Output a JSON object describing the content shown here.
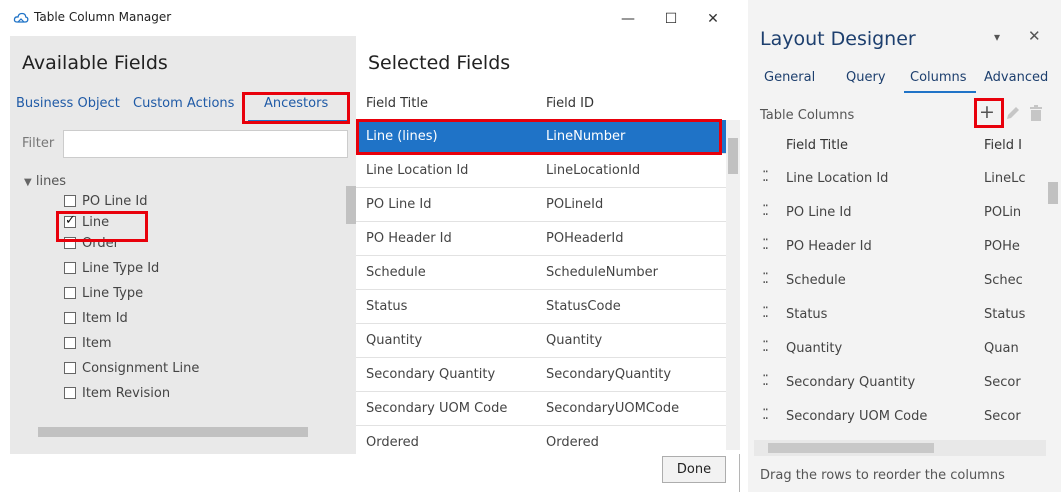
{
  "dialog": {
    "title": "Table Column Manager",
    "controls": {
      "minimize": "—",
      "maximize": "☐",
      "close": "✕"
    },
    "available": {
      "heading": "Available Fields",
      "tabs": [
        "Business Object",
        "Custom Actions",
        "Ancestors"
      ],
      "filter_label": "Filter",
      "filter_value": "",
      "tree_root": "lines",
      "items": [
        {
          "label": "PO Line Id",
          "checked": false
        },
        {
          "label": "Line",
          "checked": true
        },
        {
          "label": "Order",
          "checked": false
        },
        {
          "label": "Line Type Id",
          "checked": false
        },
        {
          "label": "Line Type",
          "checked": false
        },
        {
          "label": "Item Id",
          "checked": false
        },
        {
          "label": "Item",
          "checked": false
        },
        {
          "label": "Consignment Line",
          "checked": false
        },
        {
          "label": "Item Revision",
          "checked": false
        }
      ]
    },
    "selected": {
      "heading": "Selected Fields",
      "col_title": "Field Title",
      "col_id": "Field ID",
      "rows": [
        {
          "title": "Line (lines)",
          "id": "LineNumber"
        },
        {
          "title": "Line Location Id",
          "id": "LineLocationId"
        },
        {
          "title": "PO Line Id",
          "id": "POLineId"
        },
        {
          "title": "PO Header Id",
          "id": "POHeaderId"
        },
        {
          "title": "Schedule",
          "id": "ScheduleNumber"
        },
        {
          "title": "Status",
          "id": "StatusCode"
        },
        {
          "title": "Quantity",
          "id": "Quantity"
        },
        {
          "title": "Secondary Quantity",
          "id": "SecondaryQuantity"
        },
        {
          "title": "Secondary UOM Code",
          "id": "SecondaryUOMCode"
        },
        {
          "title": "Ordered",
          "id": "Ordered"
        }
      ]
    },
    "done_label": "Done"
  },
  "designer": {
    "title": "Layout Designer",
    "pin": "▾",
    "close": "✕",
    "tabs": [
      "General",
      "Query",
      "Columns",
      "Advanced"
    ],
    "table_columns_label": "Table Columns",
    "col_title": "Field Title",
    "col_id": "Field I",
    "rows": [
      {
        "title": "Line Location Id",
        "id": "LineLc"
      },
      {
        "title": "PO Line Id",
        "id": "POLin"
      },
      {
        "title": "PO Header Id",
        "id": "POHe"
      },
      {
        "title": "Schedule",
        "id": "Schec"
      },
      {
        "title": "Status",
        "id": "Status"
      },
      {
        "title": "Quantity",
        "id": "Quan"
      },
      {
        "title": "Secondary Quantity",
        "id": "Secor"
      },
      {
        "title": "Secondary UOM Code",
        "id": "Secor"
      }
    ],
    "hint": "Drag the rows to reorder the columns"
  },
  "colors": {
    "accent": "#1f73c7",
    "highlight": "#e8000b",
    "panel_gray": "#e9e9e9",
    "link_blue": "#1f5aa6"
  }
}
